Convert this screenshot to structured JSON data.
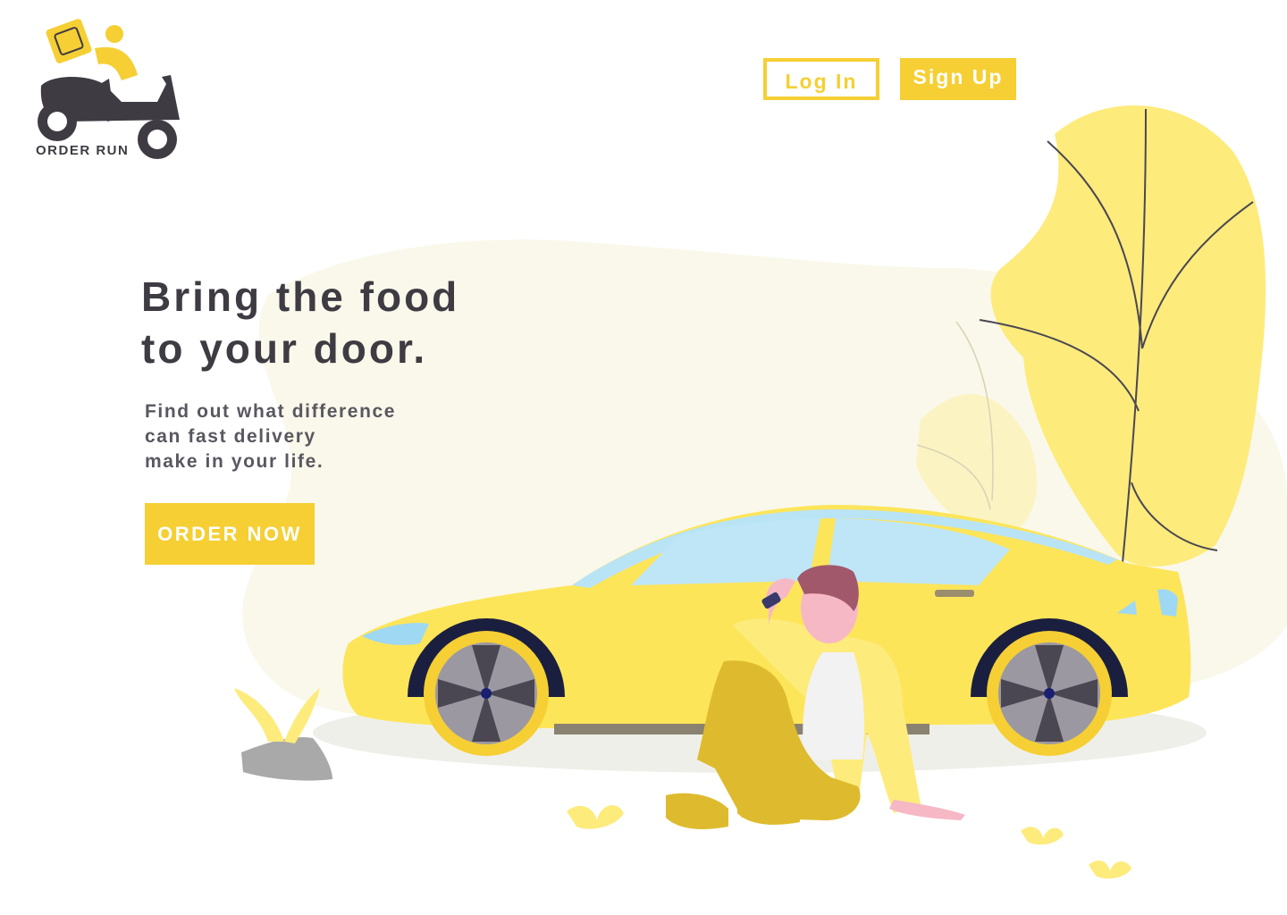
{
  "brand": {
    "name": "ORDER RUN",
    "logo_icon": "scooter-courier-icon"
  },
  "header": {
    "login_label": "Log In",
    "signup_label": "Sign Up"
  },
  "hero": {
    "title_lines": [
      "Bring the food",
      "to your door."
    ],
    "subtitle_lines": [
      "Find out what difference",
      "can fast delivery",
      "make in your life."
    ],
    "cta_label": "ORDER NOW"
  },
  "colors": {
    "accent": "#f5cf34",
    "text_dark": "#3e3b43",
    "text_muted": "#5a5760",
    "blob": "#faf8ea",
    "car_yellow": "#fde55a",
    "plant_yellow": "#fdeb7c"
  },
  "illustration": {
    "icons": [
      "sports-car-icon",
      "sitting-man-icon",
      "large-leaf-plant-icon",
      "rock-sprout-icon",
      "small-leaves-icon"
    ]
  }
}
